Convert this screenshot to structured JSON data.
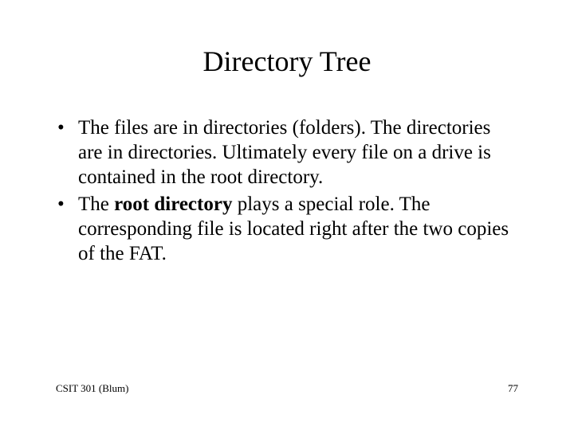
{
  "title": "Directory Tree",
  "bullets": [
    {
      "pre": "The files are in directories (folders).  The directories are in directories.  Ultimately every file on a drive is contained in the root directory.",
      "bold": "",
      "post": ""
    },
    {
      "pre": "The ",
      "bold": "root directory",
      "post": " plays a special role.  The corresponding file is located right after the two copies of the FAT."
    }
  ],
  "footer": {
    "left": "CSIT 301 (Blum)",
    "right": "77"
  }
}
